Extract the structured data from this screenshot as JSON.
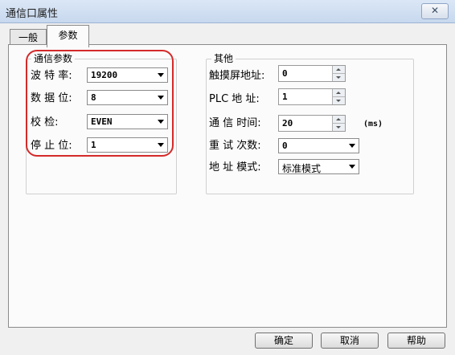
{
  "window": {
    "title": "通信口属性",
    "close_glyph": "✕"
  },
  "tabs": [
    {
      "label": "一般",
      "active": false
    },
    {
      "label": "参数",
      "active": true
    }
  ],
  "comm_group": {
    "legend": "通信参数",
    "baud_label": "波 特 率:",
    "baud_value": "19200",
    "data_bits_label": "数 据 位:",
    "data_bits_value": "8",
    "parity_label": "校    检:",
    "parity_value": "EVEN",
    "stop_bits_label": "停 止 位:",
    "stop_bits_value": "1"
  },
  "other_group": {
    "legend": "其他",
    "touch_addr_label": "触摸屏地址:",
    "touch_addr_value": "0",
    "plc_addr_label": "PLC  地 址:",
    "plc_addr_value": "1",
    "comm_time_label": "通 信 时间:",
    "comm_time_value": "20",
    "comm_time_unit": "(ms)",
    "retry_label": "重 试 次数:",
    "retry_value": "0",
    "addr_mode_label": "地 址 模式:",
    "addr_mode_value": "标准模式"
  },
  "buttons": {
    "ok": "确定",
    "cancel": "取消",
    "help": "帮助"
  },
  "colors": {
    "highlight": "#d42a2a",
    "title_bar": "#c7d8ee",
    "background": "#f0f0f0"
  }
}
